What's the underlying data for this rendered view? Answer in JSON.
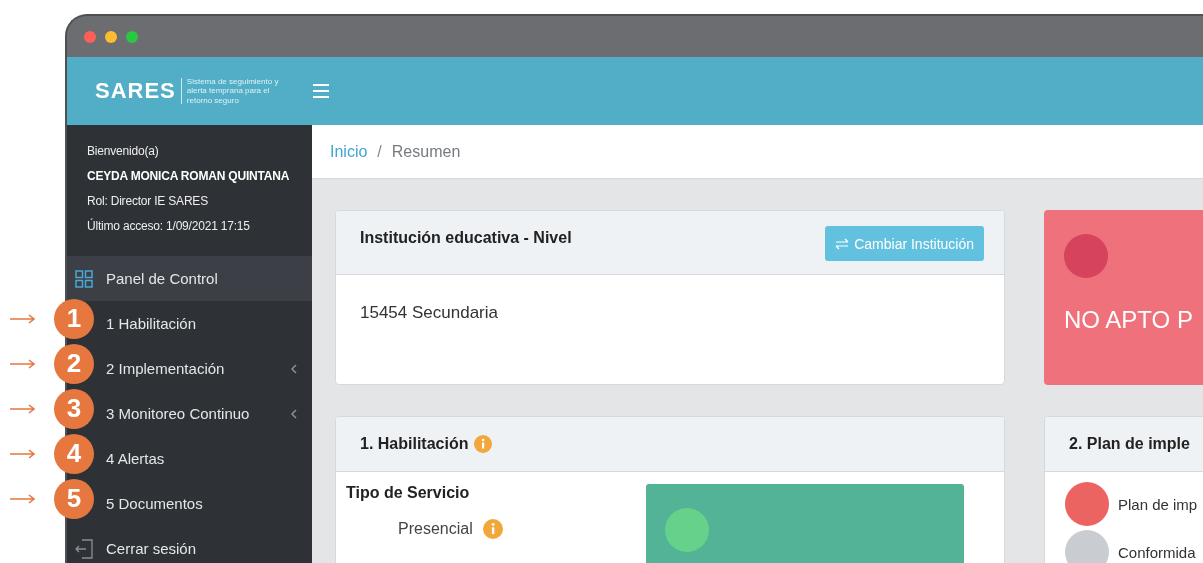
{
  "app": {
    "logo": "SARES",
    "tagline": "Sistema de seguimiento y alerta temprana para el retorno seguro"
  },
  "user": {
    "greeting": "Bienvenido(a)",
    "name": "CEYDA MONICA ROMAN QUINTANA",
    "role": "Rol: Director IE SARES",
    "last_access": "Último acceso: 1/09/2021 17:15"
  },
  "menu": [
    {
      "label": "Panel de Control",
      "kind": "dashboard",
      "selected": true
    },
    {
      "label": "1 Habilitación",
      "kind": "module",
      "selected": false
    },
    {
      "label": "2 Implementación",
      "kind": "module",
      "selected": false,
      "expanded": false
    },
    {
      "label": "3 Monitoreo Continuo",
      "kind": "module",
      "selected": false,
      "expanded": false
    },
    {
      "label": "4 Alertas",
      "kind": "module",
      "selected": false
    },
    {
      "label": "5 Documentos",
      "kind": "module",
      "selected": false
    },
    {
      "label": "Cerrar sesión",
      "kind": "logout",
      "selected": false
    }
  ],
  "callouts": [
    "1",
    "2",
    "3",
    "4",
    "5"
  ],
  "breadcrumb": {
    "separator": "/",
    "items": [
      {
        "label": "Inicio",
        "kind": "link"
      },
      {
        "label": "Resumen",
        "kind": "current"
      }
    ]
  },
  "institution_card": {
    "title": "Institución educativa - Nivel",
    "button": "Cambiar Institución",
    "value": "15454 Secundaria"
  },
  "status_card": {
    "kind": "danger",
    "text": "NO APTO P"
  },
  "habilitacion_card": {
    "title": "1. Habilitación",
    "section": "Tipo de Servicio",
    "service": "Presencial",
    "result": {
      "kind": "success"
    }
  },
  "plan_card": {
    "title": "2. Plan de imple",
    "legend": [
      {
        "label": "Plan de imp",
        "color": "#ec6461"
      },
      {
        "label": "Conformida",
        "color": "#c9ccd1"
      }
    ]
  }
}
